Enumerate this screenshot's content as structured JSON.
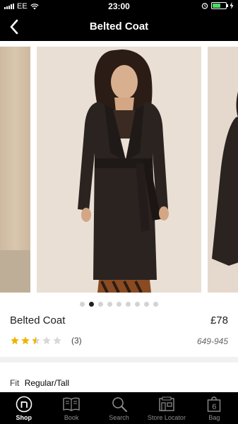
{
  "status_bar": {
    "carrier": "EE",
    "time": "23:00",
    "battery_level": 0.6,
    "battery_color": "#4cd964"
  },
  "nav": {
    "back_icon": "chevron-left-icon",
    "title": "Belted Coat"
  },
  "carousel": {
    "total_images": 9,
    "active_index": 1
  },
  "product": {
    "name": "Belted Coat",
    "price": "£78",
    "rating": 2.5,
    "rating_max": 5,
    "review_count": "(3)",
    "code": "649-945",
    "fit_label": "Fit",
    "fit_value": "Regular/Tall"
  },
  "colors": {
    "star_filled": "#f0b400",
    "star_empty": "#d8d8d8",
    "coat": "#2a2320"
  },
  "tabs": [
    {
      "label": "Shop",
      "icon": "shop-logo-icon",
      "active": true
    },
    {
      "label": "Book",
      "icon": "book-icon",
      "active": false
    },
    {
      "label": "Search",
      "icon": "search-icon",
      "active": false
    },
    {
      "label": "Store Locator",
      "icon": "store-locator-icon",
      "active": false
    },
    {
      "label": "Bag",
      "icon": "bag-icon",
      "active": false,
      "badge": "6"
    }
  ]
}
